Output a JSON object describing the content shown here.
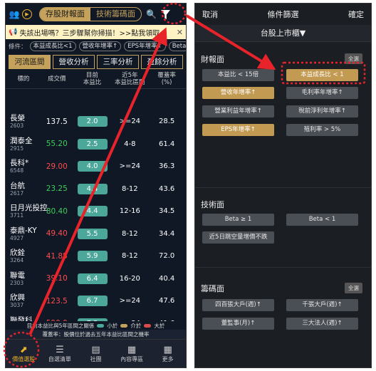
{
  "left": {
    "segments": [
      "存股財報面",
      "技術籌碼面"
    ],
    "marquee": "失該出場嗎？三步驟幫你掃描！>>點我領取e",
    "conditions_label": "條件：",
    "condition_chips": [
      "本益成長比<1",
      "營收年增率↑",
      "EPS年增率↑",
      "Beta"
    ],
    "tabs": [
      "河流區間",
      "營收分析",
      "三率分析",
      "盈餘分析"
    ],
    "headers": {
      "name": "標的",
      "volume": "成交價",
      "pe_now_a": "目前",
      "pe_now_b": "本益比",
      "pe_range_a": "近5年",
      "pe_range_b": "本益比區間",
      "coverage_a": "覆蓋率",
      "coverage_b": "(%)"
    },
    "rows": [
      {
        "name": "長榮",
        "code": "2603",
        "price": "137.5",
        "price_color": "#ffffff",
        "pe": "2.0",
        "range": ">=24",
        "cov": "28.5"
      },
      {
        "name": "潤泰全",
        "code": "2915",
        "price": "55.20",
        "price_color": "#3ccf5a",
        "pe": "2.5",
        "range": "4-8",
        "cov": "61.4"
      },
      {
        "name": "長科*",
        "code": "6548",
        "price": "29.00",
        "price_color": "#ff4d4d",
        "pe": "4.0",
        "range": ">=24",
        "cov": "36.3"
      },
      {
        "name": "台航",
        "code": "2617",
        "price": "23.25",
        "price_color": "#3ccf5a",
        "pe": "4.4",
        "range": "8-12",
        "cov": "43.6"
      },
      {
        "name": "日月光投控",
        "code": "3711",
        "price": "80.40",
        "price_color": "#3ccf5a",
        "pe": "4.4",
        "range": "12-16",
        "cov": "34.5"
      },
      {
        "name": "泰鼎-KY",
        "code": "4927",
        "price": "49.40",
        "price_color": "#ff4d4d",
        "pe": "5.5",
        "range": "8-12",
        "cov": "34.4"
      },
      {
        "name": "欣銓",
        "code": "3264",
        "price": "41.85",
        "price_color": "#ff4d4d",
        "pe": "5.9",
        "range": "8-12",
        "cov": "72.0"
      },
      {
        "name": "聯電",
        "code": "2303",
        "price": "39.10",
        "price_color": "#ff4d4d",
        "pe": "6.4",
        "range": "16-20",
        "cov": "40.4"
      },
      {
        "name": "欣興",
        "code": "3037",
        "price": "123.5",
        "price_color": "#ff4d4d",
        "pe": "6.7",
        "range": ">=24",
        "cov": "47.6"
      },
      {
        "name": "聯發科",
        "code": "2454",
        "price": "590.0",
        "price_color": "#ff4d4d",
        "pe": "7.3",
        "range": ">=24",
        "cov": "41.6"
      },
      {
        "name": "博智",
        "code": "8155",
        "price": "87.40",
        "price_color": "#ff4d4d",
        "pe": "7.4",
        "range": "8-12",
        "cov": "30.4"
      }
    ],
    "legend_prefix": "目前本益比與5年區間之關係",
    "legend_items": [
      {
        "label": "小於",
        "color": "#4aa79a"
      },
      {
        "label": "介於",
        "color": "#c5a25c"
      },
      {
        "label": "大於",
        "color": "#d94c4c"
      }
    ],
    "legend2": "覆蓋率：股價位於過去五年本益比區間之機率",
    "nav": [
      {
        "label": "價值選股",
        "icon": "⬈"
      },
      {
        "label": "自選清單",
        "icon": "☰"
      },
      {
        "label": "社團",
        "icon": "▤"
      },
      {
        "label": "內容專區",
        "icon": "▦"
      },
      {
        "label": "更多",
        "icon": "▦"
      }
    ]
  },
  "right": {
    "cancel": "取消",
    "title": "條件篩選",
    "confirm": "確定",
    "market": "台股上市櫃▼",
    "sections": {
      "finance": "財報面",
      "technical": "技術面",
      "chips": "籌碼面"
    },
    "select_all": "全選",
    "finance_opts": [
      "本益比 < 15倍",
      "本益成長比 < 1",
      "營收年增率↑",
      "毛利率年增率↑",
      "營業利益年增率↑",
      "稅前淨利年增率↑",
      "EPS年增率↑",
      "殖利率 > 5%"
    ],
    "technical_opts": [
      "Beta ≥ 1",
      "Beta < 1",
      "近5日跳空量增價不跌"
    ],
    "chips_opts": [
      "四百張大戶(週)↑",
      "千張大戶(週)↑",
      "董監事(月)↑",
      "三大法人(週)↑"
    ]
  }
}
